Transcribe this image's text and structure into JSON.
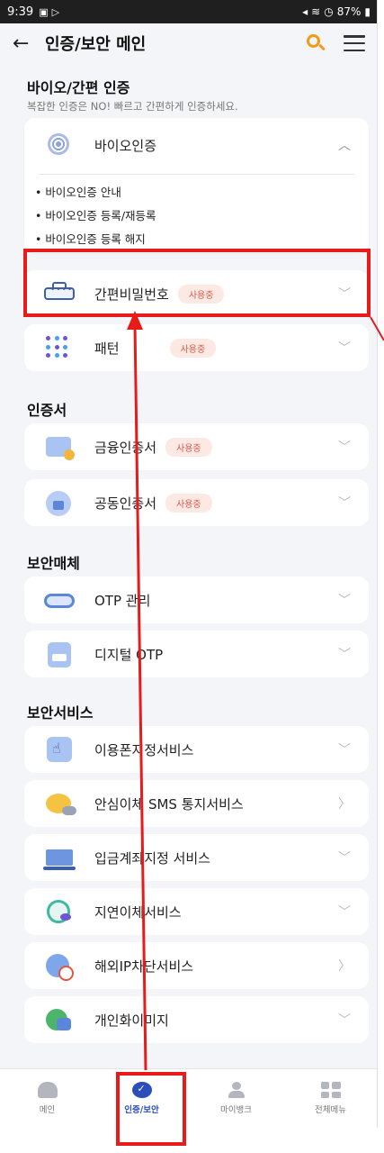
{
  "status_bar": {
    "time": "9:39",
    "battery": "87%"
  },
  "app_bar": {
    "title": "인증/보안 메인"
  },
  "bio_section": {
    "title": "바이오/간편 인증",
    "subtitle": "복잡한 인증은 NO! 빠르고 간편하게 인증하세요.",
    "bio_item": {
      "label": "바이오인증",
      "links": [
        "• 바이오인증 안내",
        "• 바이오인증 등록/재등록",
        "• 바이오인증 등록 해지"
      ]
    },
    "simple_pw": {
      "label": "간편비밀번호",
      "badge": "사용중"
    },
    "pattern": {
      "label": "패턴",
      "badge": "사용중"
    }
  },
  "cert_section": {
    "title": "인증서",
    "items": [
      {
        "label": "금융인증서",
        "badge": "사용중"
      },
      {
        "label": "공동인증서",
        "badge": "사용중"
      }
    ]
  },
  "media_section": {
    "title": "보안매체",
    "items": [
      {
        "label": "OTP 관리"
      },
      {
        "label": "디지털 OTP"
      }
    ]
  },
  "service_section": {
    "title": "보안서비스",
    "items": [
      {
        "label": "이용폰지정서비스"
      },
      {
        "label": "안심이체 SMS 통지서비스"
      },
      {
        "label": "입금계좌지정 서비스"
      },
      {
        "label": "지연이체서비스"
      },
      {
        "label": "해외IP차단서비스"
      },
      {
        "label": "개인화이미지"
      }
    ]
  },
  "bottom_nav": {
    "items": [
      {
        "label": "메인"
      },
      {
        "label": "인증/보안"
      },
      {
        "label": "마이뱅크"
      },
      {
        "label": "전체메뉴"
      }
    ]
  },
  "colors": {
    "accent": "#2b4fb8",
    "highlight": "#e81b1b",
    "search": "#f39a16",
    "badge_text": "#d55a4a"
  }
}
